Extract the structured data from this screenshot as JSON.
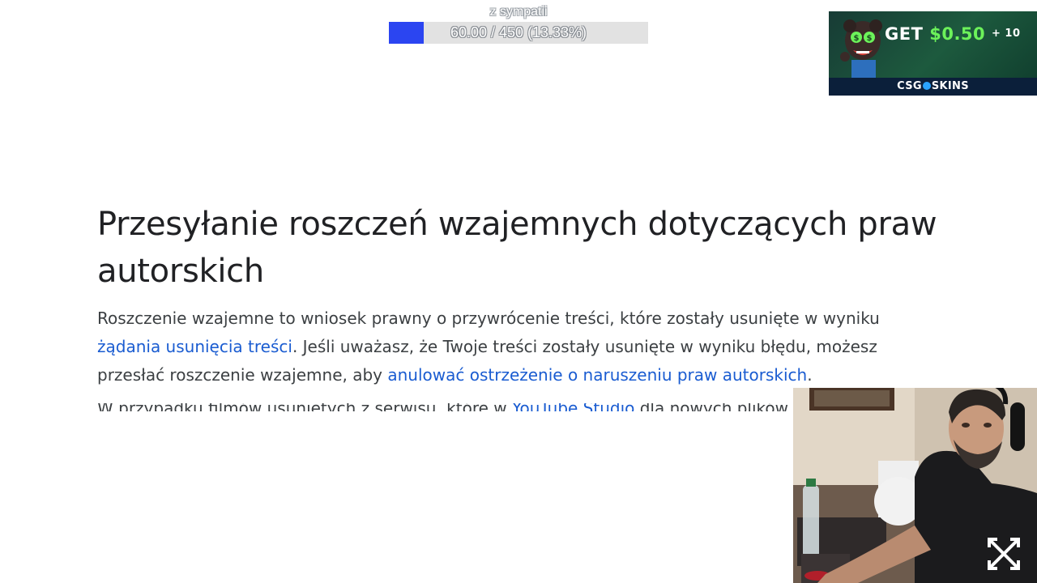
{
  "goal": {
    "title": "z sympatii",
    "progress_text": "60.00 / 450 (13.33%)",
    "current": 60,
    "target": 450,
    "percent": 13.33,
    "fill_color": "#2b45f1",
    "track_color": "#e2e2e2"
  },
  "ad": {
    "get": "GET",
    "amount": "$0.50",
    "plus": "+ 10",
    "brand_left": "CSG",
    "brand_right": "SKINS",
    "amount_color": "#6cf25a"
  },
  "article": {
    "title": "Przesyłanie roszczeń wzajemnych dotyczących praw autorskich",
    "para_text_1": "Roszczenie wzajemne to wniosek prawny o przywrócenie treści, które zostały usunięte w wyniku ",
    "link_1": "żądania usunięcia treści",
    "para_text_2": ". Jeśli uważasz, że Twoje treści zostały usunięte w wyniku błędu, możesz przesłać roszczenie wzajemne, aby ",
    "link_2": "anulować ostrzeżenie o naruszeniu praw autorskich",
    "para_text_3": ".",
    "cut_text_1": "W przypadku filmów usuniętych z serwisu, które w ",
    "cut_link": "YouTube Studio",
    "cut_text_2": " dla nowych plików formularza roszczenia",
    "link_color": "#1a5cd1"
  },
  "webcam": {
    "icon": "arrows-expand-icon"
  }
}
